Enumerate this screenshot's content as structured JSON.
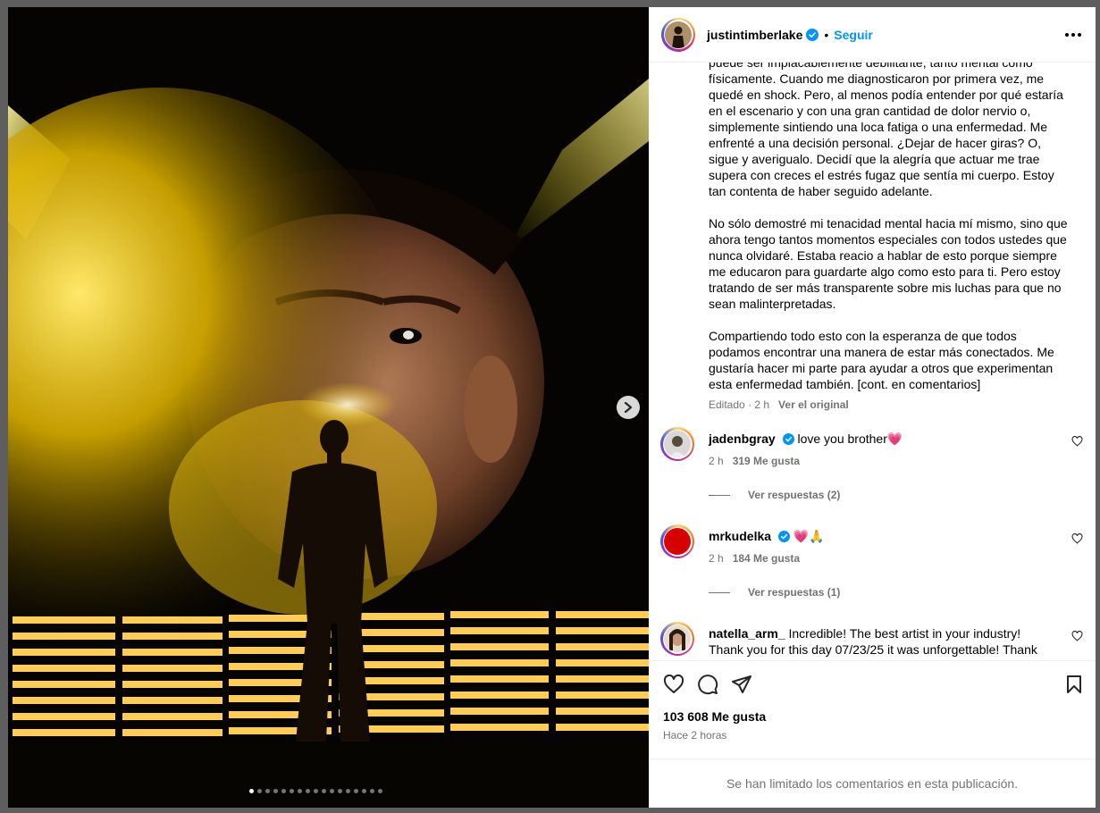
{
  "post": {
    "username": "justintimberlake",
    "follow_label": "Seguir",
    "separator": "•",
    "caption": "puede ser implacablemente debilitante, tanto mental como físicamente. Cuando me diagnosticaron por primera vez, me quedé en shock. Pero, al menos podía entender por qué estaría en el escenario y con una gran cantidad de dolor nervio o, simplemente sintiendo una loca fatiga o una enfermedad. Me enfrenté a una decisión personal. ¿Dejar de hacer giras? O, sigue y averigualo. Decidí que la alegría que actuar me trae supera con creces el estrés fugaz que sentía mi cuerpo. Estoy tan contenta de haber seguido adelante.\n\nNo sólo demostré mi tenacidad mental hacia mí mismo, sino que ahora tengo tantos momentos especiales con todos ustedes que nunca olvidaré. Estaba reacio a hablar de esto porque siempre me educaron para guardarte algo como esto para ti. Pero estoy tratando de ser más transparente sobre mis luchas para que no sean malinterpretadas.\n\nCompartiendo todo esto con la esperanza de que todos podamos encontrar una manera de estar más conectados. Me gustaría hacer mi parte para ayudar a otros que experimentan esta enfermedad también. [cont. en comentarios]",
    "edited_label": "Editado · 2 h",
    "see_original": "Ver el original",
    "likes": "103 608 Me gusta",
    "posted_time": "Hace 2 horas",
    "comments_limited": "Se han limitado los comentarios en esta publicación.",
    "carousel": {
      "total": 17,
      "active": 0
    }
  },
  "comments": [
    {
      "username": "jadenbgray",
      "verified": true,
      "text": "love you brother",
      "emoji": "💗",
      "time": "2 h",
      "likes": "319 Me gusta",
      "replies": "Ver respuestas (2)"
    },
    {
      "username": "mrkudelka",
      "verified": true,
      "text": "",
      "emoji": "💗🙏",
      "time": "2 h",
      "likes": "184 Me gusta",
      "replies": "Ver respuestas (1)"
    },
    {
      "username": "natella_arm_",
      "verified": false,
      "text": "Incredible! The best artist in your industry! Thank you for this day 07/23/25 it was unforgettable! Thank you for your music that I have been listening to for 30 years now",
      "emoji": "💔.",
      "time": "",
      "likes": "",
      "replies": ""
    }
  ],
  "colors": {
    "accent": "#0095f6",
    "muted": "#737373",
    "verified": "#0095f6",
    "heart": "#ff3b7f"
  }
}
